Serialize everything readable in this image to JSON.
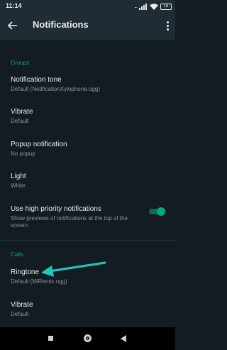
{
  "status_bar": {
    "time": "11:14",
    "signal_dots": "...",
    "battery": "16"
  },
  "app_bar": {
    "title": "Notifications",
    "back_icon": "arrow-left-icon",
    "more_icon": "more-vert-icon"
  },
  "sections": {
    "groups": {
      "header": "Groups",
      "items": [
        {
          "title": "Notification tone",
          "subtitle": "Default (NotificationXylophone.ogg)"
        },
        {
          "title": "Vibrate",
          "subtitle": "Default"
        },
        {
          "title": "Popup notification",
          "subtitle": "No popup"
        },
        {
          "title": "Light",
          "subtitle": "White"
        },
        {
          "title": "Use high priority notifications",
          "subtitle": "Show previews of notifications at the top of the screen",
          "toggle_on": true
        }
      ]
    },
    "calls": {
      "header": "Calls",
      "items": [
        {
          "title": "Ringtone",
          "subtitle": "Default (MiRemix.ogg)"
        },
        {
          "title": "Vibrate",
          "subtitle": "Default"
        }
      ]
    }
  },
  "colors": {
    "background": "#131c21",
    "app_bar": "#1f2c34",
    "accent": "#00a884",
    "annotation_arrow": "#20c9bd"
  }
}
